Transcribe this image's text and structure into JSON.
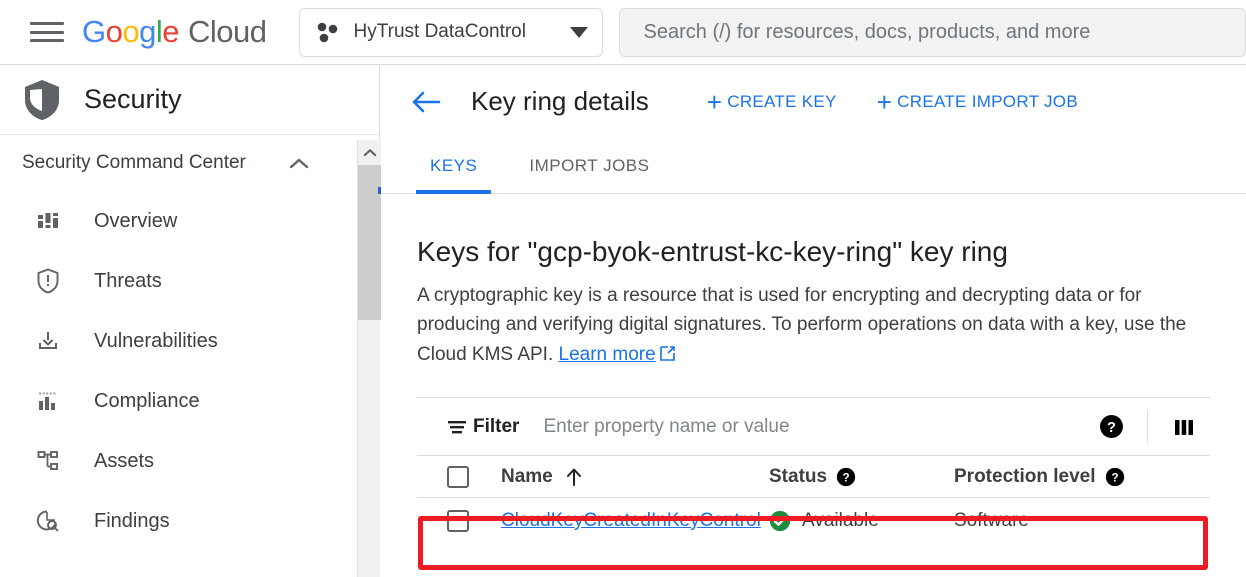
{
  "topbar": {
    "menu_icon": "hamburger-menu-icon",
    "brand": {
      "g1": "G",
      "o1": "o",
      "o2": "o",
      "g2": "g",
      "l1": "l",
      "e1": "e",
      "cloud": "Cloud"
    },
    "project": {
      "icon": "project-dots-icon",
      "name": "HyTrust DataControl",
      "dropdown_icon": "chevron-down-icon"
    },
    "search": {
      "placeholder": "Search (/) for resources, docs, products, and more",
      "value": ""
    }
  },
  "sidebar": {
    "product": {
      "icon": "shield-icon",
      "title": "Security"
    },
    "section": {
      "label": "Security Command Center",
      "collapse_icon": "chevron-up-icon"
    },
    "items": [
      {
        "label": "Overview",
        "icon": "dashboard-icon"
      },
      {
        "label": "Threats",
        "icon": "shield-alert-icon"
      },
      {
        "label": "Vulnerabilities",
        "icon": "download-tray-icon"
      },
      {
        "label": "Compliance",
        "icon": "bar-chart-icon"
      },
      {
        "label": "Assets",
        "icon": "hierarchy-icon"
      },
      {
        "label": "Findings",
        "icon": "pie-search-icon"
      }
    ],
    "scrollbar": {
      "up_arrow_icon": "chevron-up-icon"
    }
  },
  "main": {
    "header": {
      "back_icon": "back-arrow-icon",
      "title": "Key ring details",
      "actions": [
        {
          "label": "CREATE KEY",
          "plus": "+"
        },
        {
          "label": "CREATE IMPORT JOB",
          "plus": "+"
        }
      ]
    },
    "tabs": [
      {
        "label": "KEYS",
        "active": true
      },
      {
        "label": "IMPORT JOBS",
        "active": false
      }
    ],
    "section_title": "Keys for \"gcp-byok-entrust-kc-key-ring\" key ring",
    "description_part1": "A cryptographic key is a resource that is used for encrypting and decrypting data or for producing and verifying digital signatures. To perform operations on data with a key, use the Cloud KMS API.",
    "learn_more": "Learn more",
    "learn_more_icon": "external-link-icon",
    "filter": {
      "icon": "filter-icon",
      "label": "Filter",
      "placeholder": "Enter property name or value",
      "value": "",
      "help_icon": "help-filled-icon",
      "columns_icon": "column-display-icon"
    },
    "table": {
      "select_all_checkbox": "unchecked",
      "columns": [
        {
          "label": "Name",
          "sort_icon": "sort-ascending-arrow-icon",
          "help_icon": null
        },
        {
          "label": "Status",
          "sort_icon": null,
          "help_icon": "help-filled-icon"
        },
        {
          "label": "Protection level",
          "sort_icon": null,
          "help_icon": "help-filled-icon"
        }
      ],
      "rows": [
        {
          "checkbox": "unchecked",
          "name": "CloudKeyCreatedInKeyControl",
          "status": "Available",
          "status_icon": "check-circle-icon",
          "protection_level": "Software",
          "highlighted": true
        }
      ]
    }
  },
  "colors": {
    "accent_blue": "#1a73e8",
    "highlight_red": "#ed1c24",
    "status_green": "#1e8e3e",
    "text_primary": "#202124",
    "text_secondary": "#3c4043",
    "border": "#dadce0"
  }
}
